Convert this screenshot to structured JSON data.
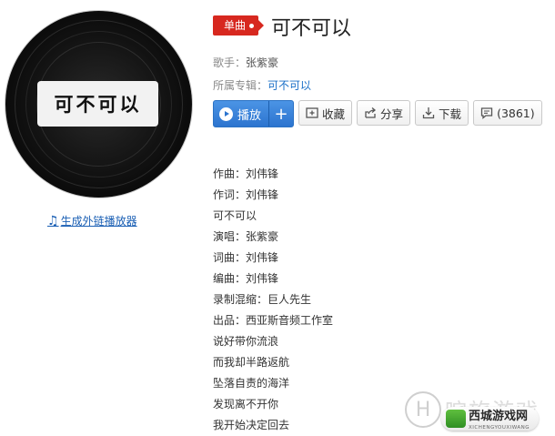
{
  "album_art": {
    "label_text": "可不可以"
  },
  "generate_link": "生成外链播放器",
  "header": {
    "badge": "单曲",
    "title": "可不可以"
  },
  "meta": {
    "singer_label": "歌手：",
    "singer": "张紫豪",
    "album_label": "所属专辑：",
    "album": "可不可以"
  },
  "actions": {
    "play": "播放",
    "add": "+",
    "collect": "收藏",
    "share": "分享",
    "download": "下载",
    "comment_count": "(3861)"
  },
  "lyrics": [
    "作曲：刘伟锋",
    "作词：刘伟锋",
    "可不可以",
    "演唱：张紫豪",
    "词曲：刘伟锋",
    "编曲：刘伟锋",
    "录制混缩：巨人先生",
    "出品：西亚斯音频工作室",
    "说好带你流浪",
    "而我却半路返航",
    "坠落自责的海洋",
    "发现离不开你",
    "我开始决定回去"
  ],
  "watermark": {
    "circle_letter": "H",
    "faint_text": "咤旅游戏",
    "brand": "西城游戏网",
    "sub": "XICHENGYOUXIWANG"
  },
  "colors": {
    "badge_red": "#d7281f",
    "play_blue": "#2c74cf",
    "link_blue": "#1a6fc7"
  }
}
